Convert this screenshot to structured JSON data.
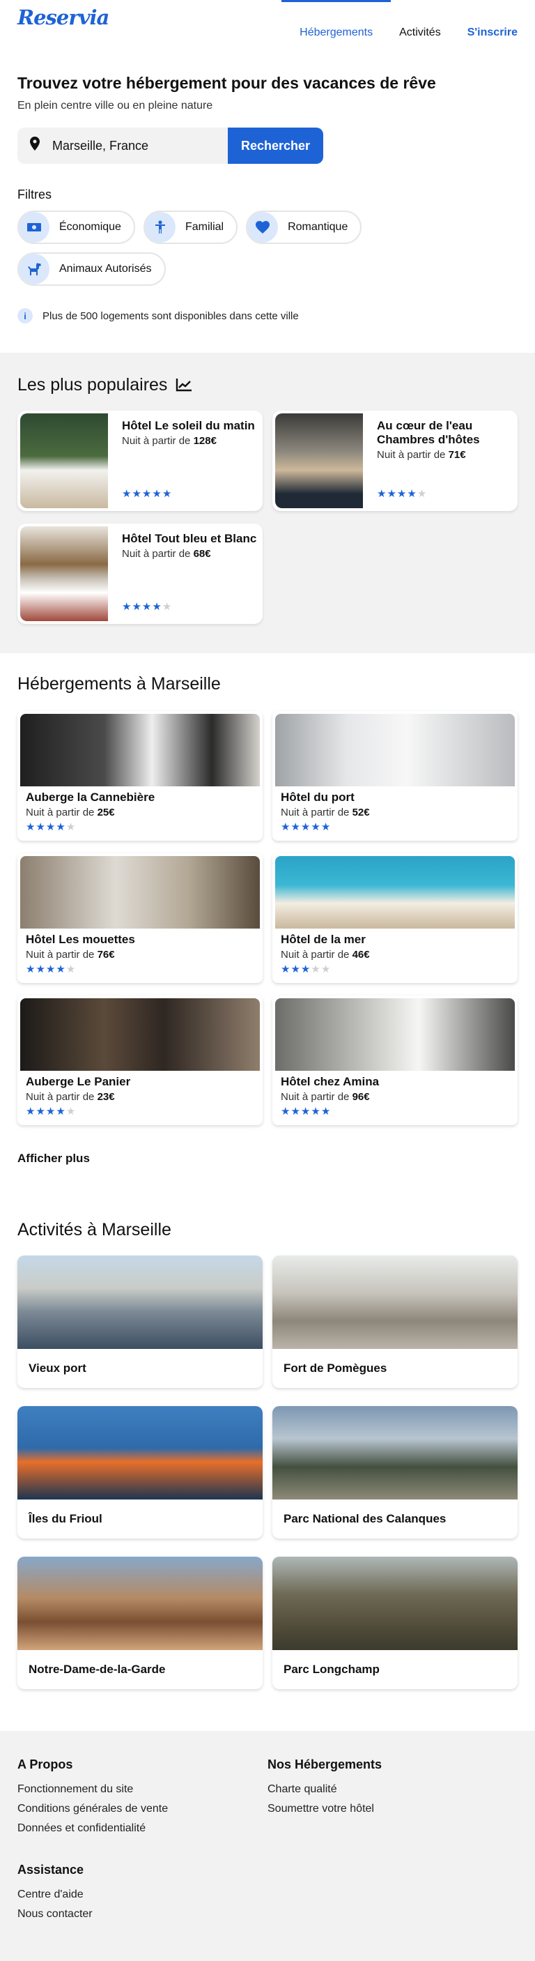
{
  "brand": {
    "logo": "Reservia",
    "accent": "#1e63d6"
  },
  "nav": {
    "hebergements": "Hébergements",
    "activites": "Activités",
    "signup": "S'inscrire"
  },
  "hero": {
    "title": "Trouvez votre hébergement pour des vacances de rêve",
    "subtitle": "En plein centre ville ou en pleine nature",
    "search_value": "Marseille, France",
    "search_button": "Rechercher"
  },
  "filters": {
    "title": "Filtres",
    "items": [
      {
        "label": "Économique",
        "icon": "money-icon"
      },
      {
        "label": "Familial",
        "icon": "child-icon"
      },
      {
        "label": "Romantique",
        "icon": "heart-icon"
      },
      {
        "label": "Animaux Autorisés",
        "icon": "dog-icon"
      }
    ]
  },
  "info": "Plus de 500 logements sont disponibles dans cette ville",
  "popular": {
    "title": "Les plus populaires",
    "price_prefix": "Nuit à partir de",
    "items": [
      {
        "name": "Hôtel Le soleil du matin",
        "price": "128€",
        "rating": 5
      },
      {
        "name": "Au cœur de l'eau Chambres d'hôtes",
        "price": "71€",
        "rating": 4
      },
      {
        "name": "Hôtel Tout bleu et Blanc",
        "price": "68€",
        "rating": 4
      }
    ]
  },
  "lodgings": {
    "title": "Hébergements à Marseille",
    "price_prefix": "Nuit à partir de",
    "items": [
      {
        "name": "Auberge la Cannebière",
        "price": "25€",
        "rating": 4
      },
      {
        "name": "Hôtel du port",
        "price": "52€",
        "rating": 5
      },
      {
        "name": "Hôtel Les mouettes",
        "price": "76€",
        "rating": 4
      },
      {
        "name": "Hôtel de la mer",
        "price": "46€",
        "rating": 3
      },
      {
        "name": "Auberge Le Panier",
        "price": "23€",
        "rating": 4
      },
      {
        "name": "Hôtel chez Amina",
        "price": "96€",
        "rating": 5
      }
    ],
    "more": "Afficher plus"
  },
  "activities": {
    "title": "Activités à Marseille",
    "items": [
      {
        "name": "Vieux port"
      },
      {
        "name": "Fort de Pomègues"
      },
      {
        "name": "Îles du Frioul"
      },
      {
        "name": "Parc National des Calanques"
      },
      {
        "name": "Notre-Dame-de-la-Garde"
      },
      {
        "name": "Parc Longchamp"
      }
    ]
  },
  "footer": {
    "about": {
      "title": "A Propos",
      "links": [
        "Fonctionnement du site",
        "Conditions générales de vente",
        "Données et confidentialité"
      ]
    },
    "lodgings": {
      "title": "Nos Hébergements",
      "links": [
        "Charte qualité",
        "Soumettre votre hôtel"
      ]
    },
    "help": {
      "title": "Assistance",
      "links": [
        "Centre d'aide",
        "Nous contacter"
      ]
    }
  }
}
